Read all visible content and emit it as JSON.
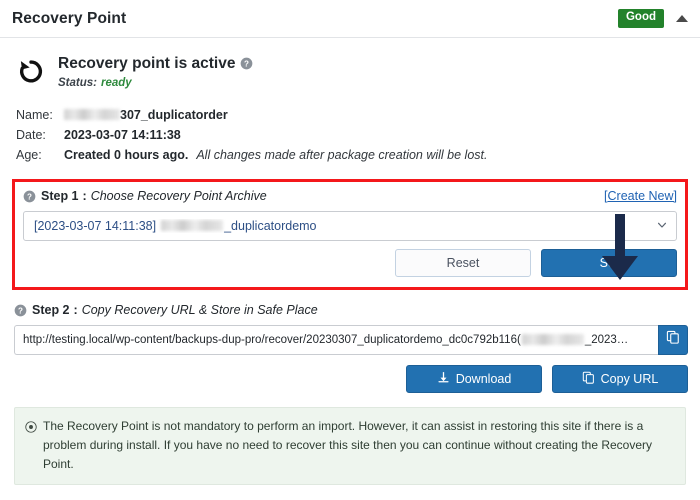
{
  "header": {
    "title": "Recovery Point",
    "status_badge": "Good",
    "collapse_icon": "caret-up-icon",
    "badge_color": "#23822b"
  },
  "summary": {
    "icon": "restore-rotate-left-icon",
    "title": "Recovery point is active",
    "help_icon": "help-circle-icon",
    "status_label": "Status:",
    "status_value": "ready",
    "status_color": "#2f8a3e"
  },
  "details": {
    "name_label": "Name:",
    "name_value": "307_duplicatorder",
    "date_label": "Date:",
    "date_value": "2023-03-07 14:11:38",
    "age_label": "Age:",
    "age_value": "Created 0 hours ago.",
    "age_note": "All changes made after package creation will be lost."
  },
  "step1": {
    "help_icon": "help-circle-icon",
    "number": "Step 1",
    "separator": ":",
    "title": "Choose Recovery Point Archive",
    "create_new": "[Create New]",
    "create_new_color": "#2063b3",
    "select_value_prefix": "[2023-03-07 14:11:38]",
    "select_value_suffix": "_duplicatordemo",
    "select_caret_icon": "chevron-down-icon",
    "reset_label": "Reset",
    "set_label": "Set",
    "highlight_color": "#f4181b",
    "primary_color": "#2271b1"
  },
  "step2": {
    "help_icon": "help-circle-icon",
    "number": "Step 2",
    "separator": ":",
    "title": "Copy Recovery URL & Store in Safe Place",
    "url_prefix": "http://testing.local/wp-content/backups-dup-pro/recover/20230307_duplicatordemo_dc0c792b116(",
    "url_suffix": "_2023…",
    "copy_icon": "copy-icon",
    "download_label": "Download",
    "download_icon": "download-icon",
    "copy_url_label": "Copy URL",
    "copy_url_icon": "copy-icon"
  },
  "notice": {
    "icon": "info-circle-icon",
    "text": "The Recovery Point is not mandatory to perform an import. However, it can assist in restoring this site if there is a problem during install. If you have no need to recover this site then you can continue without creating the Recovery Point."
  },
  "annotation": {
    "arrow_icon": "down-arrow-annotation",
    "arrow_color": "#1b2a4a"
  }
}
